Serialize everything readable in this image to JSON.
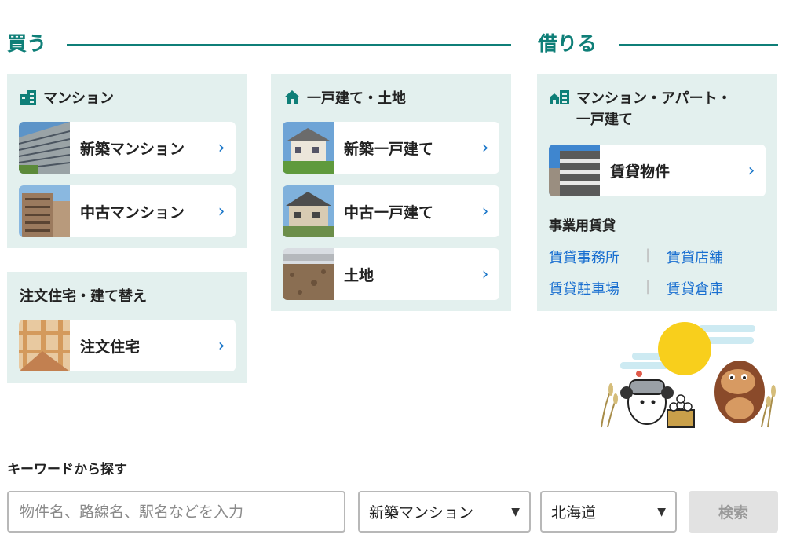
{
  "buy": {
    "title": "買う",
    "mansion": {
      "heading": "マンション",
      "icon": "building-icon",
      "items": [
        {
          "label": "新築マンション"
        },
        {
          "label": "中古マンション"
        }
      ]
    },
    "house": {
      "heading": "一戸建て・土地",
      "icon": "house-icon",
      "items": [
        {
          "label": "新築一戸建て"
        },
        {
          "label": "中古一戸建て"
        },
        {
          "label": "土地"
        }
      ]
    },
    "custom": {
      "heading": "注文住宅・建て替え",
      "items": [
        {
          "label": "注文住宅"
        }
      ]
    }
  },
  "rent": {
    "title": "借りる",
    "heading_line1": "マンション・アパート・",
    "heading_line2": "一戸建て",
    "icon": "house-building-icon",
    "items": [
      {
        "label": "賃貸物件"
      }
    ],
    "business": {
      "title": "事業用賃貸",
      "links": [
        "賃貸事務所",
        "賃貸店舗",
        "賃貸駐車場",
        "賃貸倉庫"
      ]
    }
  },
  "keyword": {
    "title": "キーワードから探す",
    "placeholder": "物件名、路線名、駅名などを入力",
    "type_select": "新築マンション",
    "area_select": "北海道",
    "search_label": "検索"
  },
  "colors": {
    "accent": "#0f7f78",
    "panel": "#e3f0ee",
    "link": "#1a6fd0"
  }
}
